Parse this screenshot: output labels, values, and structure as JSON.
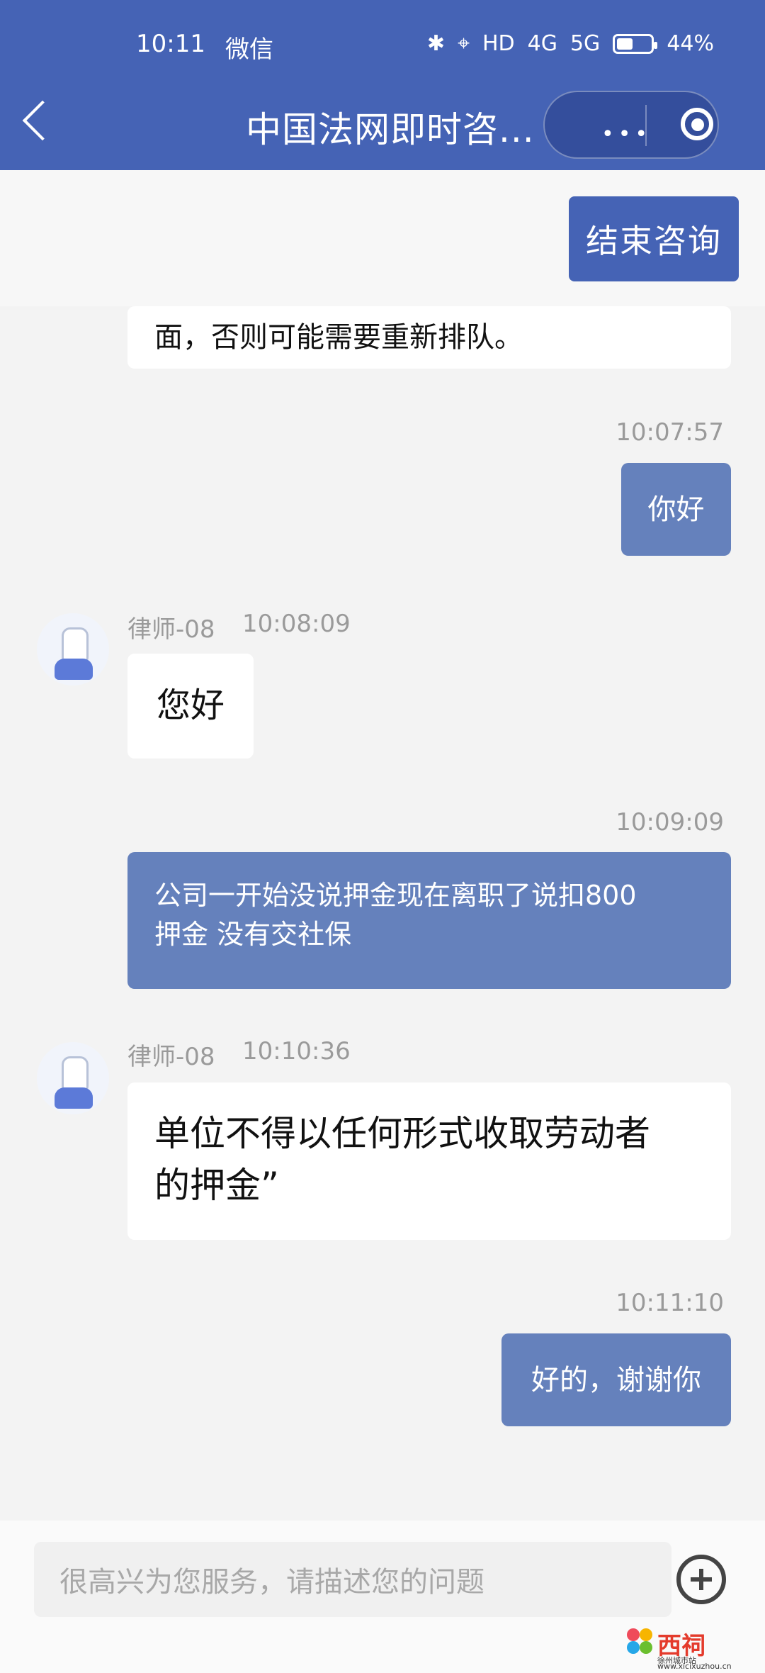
{
  "status": {
    "time": "10:11",
    "wechat": "微信",
    "hd": "HD",
    "network1": "4G",
    "network2": "5G",
    "battery": "44%"
  },
  "header": {
    "title": "中国法网即时咨...",
    "menu": "•••"
  },
  "buttons": {
    "end": "结束咨询"
  },
  "messages": [
    {
      "text": "面，否则可能需要重新排队。"
    },
    {
      "time": "10:07:57",
      "text": "你好"
    },
    {
      "sender": "律师-08",
      "time": "10:08:09",
      "text": "您好"
    },
    {
      "time": "10:09:09",
      "line1": "公司一开始没说押金现在离职了说扣800",
      "line2": "押金 没有交社保"
    },
    {
      "sender": "律师-08",
      "time": "10:10:36",
      "line1": "单位不得以任何形式收取劳动者",
      "line2": "的押金”"
    },
    {
      "time": "10:11:10",
      "text": "好的，谢谢你"
    }
  ],
  "input": {
    "placeholder": "很高兴为您服务，请描述您的问题"
  },
  "watermark": {
    "name": "西祠",
    "sub": "徐州城市站",
    "url": "www.xicixuzhou.cn"
  },
  "colors": {
    "header": "#4563b5",
    "my_bubble": "#6581bc"
  }
}
